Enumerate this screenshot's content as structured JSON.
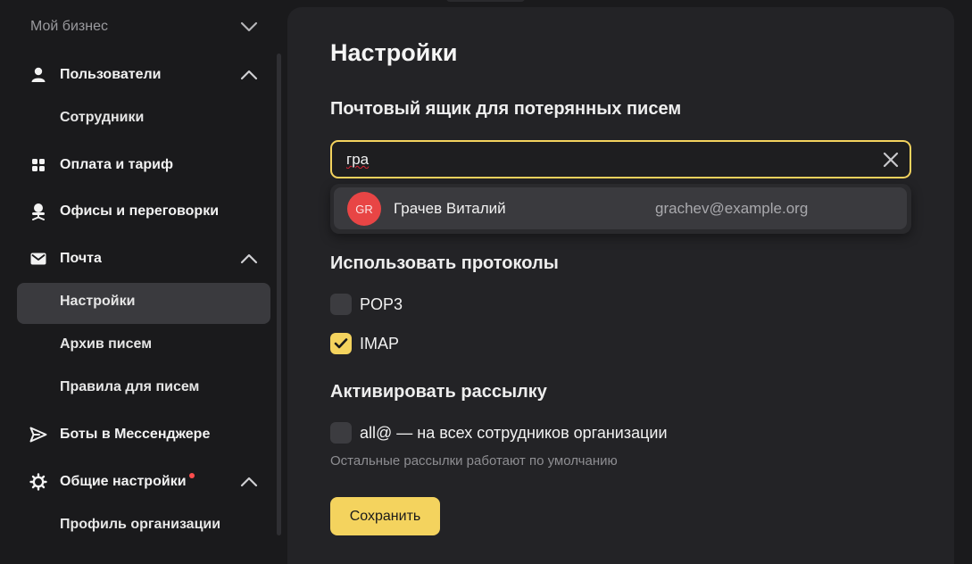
{
  "sidebar": {
    "section_title": "Мой бизнес",
    "items": [
      {
        "label": "Пользователи",
        "icon": "user-icon"
      },
      {
        "label": "Сотрудники"
      },
      {
        "label": "Оплата и тариф",
        "icon": "grid-icon"
      },
      {
        "label": "Офисы и переговорки",
        "icon": "chair-icon"
      },
      {
        "label": "Почта",
        "icon": "mail-icon"
      },
      {
        "label": "Настройки",
        "active": true
      },
      {
        "label": "Архив писем"
      },
      {
        "label": "Правила для писем"
      },
      {
        "label": "Боты в Мессенджере",
        "icon": "send-icon"
      },
      {
        "label": "Общие настройки",
        "icon": "gear-icon",
        "notification": true
      },
      {
        "label": "Профиль организации"
      }
    ]
  },
  "main": {
    "title": "Настройки",
    "lost_mailbox": {
      "heading": "Почтовый ящик для потерянных писем",
      "input_value": "гра",
      "suggestion": {
        "initials": "GR",
        "name": "Грачев Виталий",
        "email": "grachev@example.org"
      }
    },
    "protocols": {
      "heading": "Использовать протоколы",
      "options": [
        {
          "label": "POP3",
          "checked": false
        },
        {
          "label": "IMAP",
          "checked": true
        }
      ]
    },
    "mailing": {
      "heading": "Активировать рассылку",
      "option_label": "all@ — на всех сотрудников организации",
      "option_checked": false,
      "hint": "Остальные рассылки работают по умолчанию"
    },
    "save_label": "Сохранить"
  },
  "colors": {
    "accent": "#f4d35e",
    "avatar": "#e84545",
    "notification": "#ff4d4d"
  }
}
